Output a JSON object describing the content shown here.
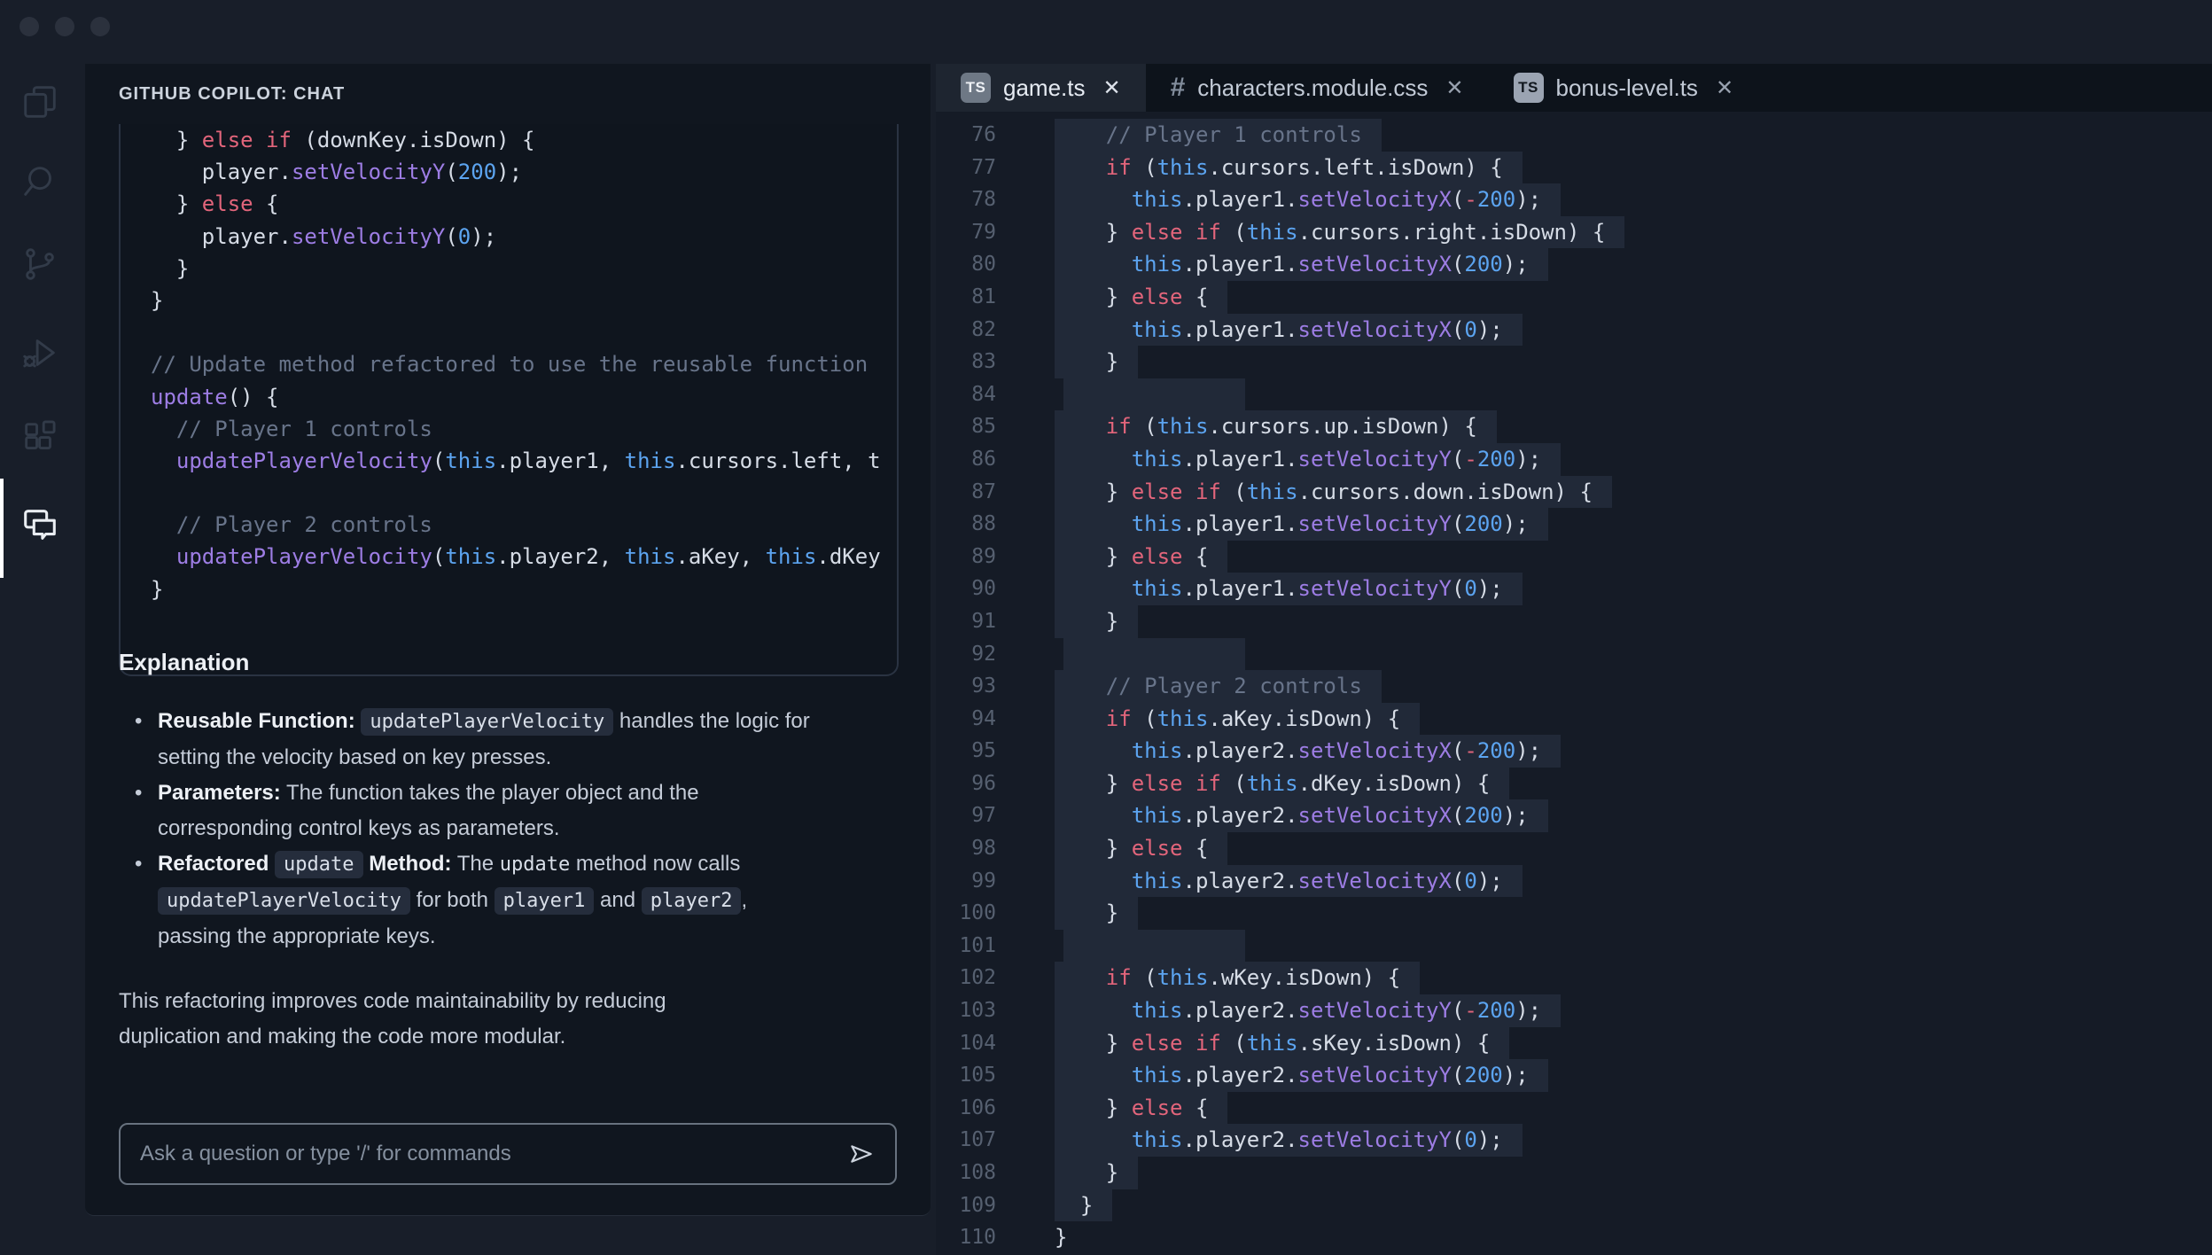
{
  "window": {
    "controls": [
      {
        "icon": "window-close-button"
      },
      {
        "icon": "window-minimize-button"
      },
      {
        "icon": "window-zoom-button"
      }
    ]
  },
  "activity_bar": {
    "items": [
      {
        "icon": "files-icon",
        "active": false
      },
      {
        "icon": "search-icon",
        "active": false
      },
      {
        "icon": "source-control-icon",
        "active": false
      },
      {
        "icon": "run-debug-icon",
        "active": false
      },
      {
        "icon": "extensions-icon",
        "active": false
      },
      {
        "icon": "chat-icon",
        "active": true
      }
    ]
  },
  "colors": {
    "window_bg": "#181e29",
    "panel_bg": "#10161f",
    "editor_bg": "#151b26",
    "tabbar_bg": "#0d131b",
    "active_tab_bg": "#1e2530",
    "highlight_line_bg": "#212938",
    "keyword": "#e2657b",
    "function": "#9d7de4",
    "blue_identifier": "#5ca4f0",
    "comment": "#68748a",
    "plain_code": "#d6dce6",
    "chip_bg": "#252d3c",
    "active_indicator": "#ffffff"
  },
  "chat": {
    "header": "GITHUB COPILOT: CHAT",
    "code_block": {
      "lines": [
        [
          [
            "p",
            "  } "
          ],
          [
            "k",
            "else"
          ],
          [
            "p",
            " "
          ],
          [
            "k",
            "if"
          ],
          [
            "p",
            " (downKey.isDown) {"
          ]
        ],
        [
          [
            "p",
            "    player."
          ],
          [
            "f",
            "setVelocityY"
          ],
          [
            "p",
            "("
          ],
          [
            "n",
            "200"
          ],
          [
            "p",
            ");"
          ]
        ],
        [
          [
            "p",
            "  } "
          ],
          [
            "k",
            "else"
          ],
          [
            "p",
            " {"
          ]
        ],
        [
          [
            "p",
            "    player."
          ],
          [
            "f",
            "setVelocityY"
          ],
          [
            "p",
            "("
          ],
          [
            "n",
            "0"
          ],
          [
            "p",
            ");"
          ]
        ],
        [
          [
            "p",
            "  }"
          ]
        ],
        [
          [
            "p",
            "}"
          ]
        ],
        [],
        [
          [
            "c",
            "// Update method refactored to use the reusable function"
          ]
        ],
        [
          [
            "f",
            "update"
          ],
          [
            "p",
            "() {"
          ]
        ],
        [
          [
            "c",
            "  // Player 1 controls"
          ]
        ],
        [
          [
            "p",
            "  "
          ],
          [
            "f",
            "updatePlayerVelocity"
          ],
          [
            "p",
            "("
          ],
          [
            "t",
            "this"
          ],
          [
            "p",
            ".player1, "
          ],
          [
            "t",
            "this"
          ],
          [
            "p",
            ".cursors.left, t"
          ]
        ],
        [],
        [
          [
            "c",
            "  // Player 2 controls"
          ]
        ],
        [
          [
            "p",
            "  "
          ],
          [
            "f",
            "updatePlayerVelocity"
          ],
          [
            "p",
            "("
          ],
          [
            "t",
            "this"
          ],
          [
            "p",
            ".player2, "
          ],
          [
            "t",
            "this"
          ],
          [
            "p",
            ".aKey, "
          ],
          [
            "t",
            "this"
          ],
          [
            "p",
            ".dKey"
          ]
        ],
        [
          [
            "p",
            "}"
          ]
        ]
      ]
    },
    "explanation": {
      "heading": "Explanation",
      "bullet_glyph": "•",
      "bullets": [
        [
          {
            "s": "b",
            "t": "Reusable Function:"
          },
          {
            "s": "",
            "t": " "
          },
          {
            "s": "ch",
            "t": "updatePlayerVelocity"
          },
          {
            "s": "",
            "t": " handles the logic for setting the velocity based on key presses."
          }
        ],
        [
          {
            "s": "b",
            "t": "Parameters:"
          },
          {
            "s": "",
            "t": " The function takes the player object and the corresponding control keys as parameters."
          }
        ],
        [
          {
            "s": "b",
            "t": "Refactored"
          },
          {
            "s": "",
            "t": " "
          },
          {
            "s": "ch",
            "t": "update"
          },
          {
            "s": "",
            "t": " "
          },
          {
            "s": "b",
            "t": "Method:"
          },
          {
            "s": "",
            "t": " The "
          },
          {
            "s": "mn",
            "t": "update"
          },
          {
            "s": "",
            "t": " method now calls "
          },
          {
            "s": "ch",
            "t": "updatePlayerVelocity"
          },
          {
            "s": "",
            "t": " for both "
          },
          {
            "s": "ch",
            "t": "player1"
          },
          {
            "s": "",
            "t": " and "
          },
          {
            "s": "ch",
            "t": "player2"
          },
          {
            "s": "",
            "t": ", passing the appropriate keys."
          }
        ]
      ]
    },
    "note": "This refactoring improves code maintainability by reducing duplication and making the code more modular.",
    "input": {
      "placeholder": "Ask a question or type '/' for commands",
      "send_icon": "send-icon"
    }
  },
  "editor": {
    "close_glyph": "✕",
    "tabs": [
      {
        "icon": "ts-badge",
        "label": "game.ts",
        "active": true
      },
      {
        "icon": "css-hash-icon",
        "label": "characters.module.css",
        "active": false
      },
      {
        "icon": "ts-badge-light",
        "label": "bonus-level.ts",
        "active": false
      }
    ],
    "lines": [
      {
        "n": 76,
        "hl": true,
        "seg": [
          [
            "c",
            "    // Player 1 controls"
          ]
        ]
      },
      {
        "n": 77,
        "hl": true,
        "seg": [
          [
            "p",
            "    "
          ],
          [
            "k",
            "if"
          ],
          [
            "p",
            " ("
          ],
          [
            "t",
            "this"
          ],
          [
            "p",
            ".cursors.left.isDown) {"
          ]
        ]
      },
      {
        "n": 78,
        "hl": true,
        "seg": [
          [
            "p",
            "      "
          ],
          [
            "t",
            "this"
          ],
          [
            "p",
            ".player1."
          ],
          [
            "f",
            "setVelocityX"
          ],
          [
            "p",
            "("
          ],
          [
            "k",
            "-"
          ],
          [
            "n",
            "200"
          ],
          [
            "p",
            ");"
          ]
        ]
      },
      {
        "n": 79,
        "hl": true,
        "seg": [
          [
            "p",
            "    } "
          ],
          [
            "k",
            "else"
          ],
          [
            "p",
            " "
          ],
          [
            "k",
            "if"
          ],
          [
            "p",
            " ("
          ],
          [
            "t",
            "this"
          ],
          [
            "p",
            ".cursors.right.isDown) {"
          ]
        ]
      },
      {
        "n": 80,
        "hl": true,
        "seg": [
          [
            "p",
            "      "
          ],
          [
            "t",
            "this"
          ],
          [
            "p",
            ".player1."
          ],
          [
            "f",
            "setVelocityX"
          ],
          [
            "p",
            "("
          ],
          [
            "n",
            "200"
          ],
          [
            "p",
            ");"
          ]
        ]
      },
      {
        "n": 81,
        "hl": true,
        "seg": [
          [
            "p",
            "    } "
          ],
          [
            "k",
            "else"
          ],
          [
            "p",
            " {"
          ]
        ]
      },
      {
        "n": 82,
        "hl": true,
        "seg": [
          [
            "p",
            "      "
          ],
          [
            "t",
            "this"
          ],
          [
            "p",
            ".player1."
          ],
          [
            "f",
            "setVelocityX"
          ],
          [
            "p",
            "("
          ],
          [
            "n",
            "0"
          ],
          [
            "p",
            ");"
          ]
        ]
      },
      {
        "n": 83,
        "hl": true,
        "seg": [
          [
            "p",
            "    }"
          ]
        ]
      },
      {
        "n": 84,
        "hl": true,
        "seg": []
      },
      {
        "n": 85,
        "hl": true,
        "seg": [
          [
            "p",
            "    "
          ],
          [
            "k",
            "if"
          ],
          [
            "p",
            " ("
          ],
          [
            "t",
            "this"
          ],
          [
            "p",
            ".cursors.up.isDown) {"
          ]
        ]
      },
      {
        "n": 86,
        "hl": true,
        "seg": [
          [
            "p",
            "      "
          ],
          [
            "t",
            "this"
          ],
          [
            "p",
            ".player1."
          ],
          [
            "f",
            "setVelocityY"
          ],
          [
            "p",
            "("
          ],
          [
            "k",
            "-"
          ],
          [
            "n",
            "200"
          ],
          [
            "p",
            ");"
          ]
        ]
      },
      {
        "n": 87,
        "hl": true,
        "seg": [
          [
            "p",
            "    } "
          ],
          [
            "k",
            "else"
          ],
          [
            "p",
            " "
          ],
          [
            "k",
            "if"
          ],
          [
            "p",
            " ("
          ],
          [
            "t",
            "this"
          ],
          [
            "p",
            ".cursors.down.isDown) {"
          ]
        ]
      },
      {
        "n": 88,
        "hl": true,
        "seg": [
          [
            "p",
            "      "
          ],
          [
            "t",
            "this"
          ],
          [
            "p",
            ".player1."
          ],
          [
            "f",
            "setVelocityY"
          ],
          [
            "p",
            "("
          ],
          [
            "n",
            "200"
          ],
          [
            "p",
            ");"
          ]
        ]
      },
      {
        "n": 89,
        "hl": true,
        "seg": [
          [
            "p",
            "    } "
          ],
          [
            "k",
            "else"
          ],
          [
            "p",
            " {"
          ]
        ]
      },
      {
        "n": 90,
        "hl": true,
        "seg": [
          [
            "p",
            "      "
          ],
          [
            "t",
            "this"
          ],
          [
            "p",
            ".player1."
          ],
          [
            "f",
            "setVelocityY"
          ],
          [
            "p",
            "("
          ],
          [
            "n",
            "0"
          ],
          [
            "p",
            ");"
          ]
        ]
      },
      {
        "n": 91,
        "hl": true,
        "seg": [
          [
            "p",
            "    }"
          ]
        ]
      },
      {
        "n": 92,
        "hl": true,
        "seg": []
      },
      {
        "n": 93,
        "hl": true,
        "seg": [
          [
            "c",
            "    // Player 2 controls"
          ]
        ]
      },
      {
        "n": 94,
        "hl": true,
        "seg": [
          [
            "p",
            "    "
          ],
          [
            "k",
            "if"
          ],
          [
            "p",
            " ("
          ],
          [
            "t",
            "this"
          ],
          [
            "p",
            ".aKey.isDown) {"
          ]
        ]
      },
      {
        "n": 95,
        "hl": true,
        "seg": [
          [
            "p",
            "      "
          ],
          [
            "t",
            "this"
          ],
          [
            "p",
            ".player2."
          ],
          [
            "f",
            "setVelocityX"
          ],
          [
            "p",
            "("
          ],
          [
            "k",
            "-"
          ],
          [
            "n",
            "200"
          ],
          [
            "p",
            ");"
          ]
        ]
      },
      {
        "n": 96,
        "hl": true,
        "seg": [
          [
            "p",
            "    } "
          ],
          [
            "k",
            "else"
          ],
          [
            "p",
            " "
          ],
          [
            "k",
            "if"
          ],
          [
            "p",
            " ("
          ],
          [
            "t",
            "this"
          ],
          [
            "p",
            ".dKey.isDown) {"
          ]
        ]
      },
      {
        "n": 97,
        "hl": true,
        "seg": [
          [
            "p",
            "      "
          ],
          [
            "t",
            "this"
          ],
          [
            "p",
            ".player2."
          ],
          [
            "f",
            "setVelocityX"
          ],
          [
            "p",
            "("
          ],
          [
            "n",
            "200"
          ],
          [
            "p",
            ");"
          ]
        ]
      },
      {
        "n": 98,
        "hl": true,
        "seg": [
          [
            "p",
            "    } "
          ],
          [
            "k",
            "else"
          ],
          [
            "p",
            " {"
          ]
        ]
      },
      {
        "n": 99,
        "hl": true,
        "seg": [
          [
            "p",
            "      "
          ],
          [
            "t",
            "this"
          ],
          [
            "p",
            ".player2."
          ],
          [
            "f",
            "setVelocityX"
          ],
          [
            "p",
            "("
          ],
          [
            "n",
            "0"
          ],
          [
            "p",
            ");"
          ]
        ]
      },
      {
        "n": 100,
        "hl": true,
        "seg": [
          [
            "p",
            "    }"
          ]
        ]
      },
      {
        "n": 101,
        "hl": true,
        "seg": []
      },
      {
        "n": 102,
        "hl": true,
        "seg": [
          [
            "p",
            "    "
          ],
          [
            "k",
            "if"
          ],
          [
            "p",
            " ("
          ],
          [
            "t",
            "this"
          ],
          [
            "p",
            ".wKey.isDown) {"
          ]
        ]
      },
      {
        "n": 103,
        "hl": true,
        "seg": [
          [
            "p",
            "      "
          ],
          [
            "t",
            "this"
          ],
          [
            "p",
            ".player2."
          ],
          [
            "f",
            "setVelocityY"
          ],
          [
            "p",
            "("
          ],
          [
            "k",
            "-"
          ],
          [
            "n",
            "200"
          ],
          [
            "p",
            ");"
          ]
        ]
      },
      {
        "n": 104,
        "hl": true,
        "seg": [
          [
            "p",
            "    } "
          ],
          [
            "k",
            "else"
          ],
          [
            "p",
            " "
          ],
          [
            "k",
            "if"
          ],
          [
            "p",
            " ("
          ],
          [
            "t",
            "this"
          ],
          [
            "p",
            ".sKey.isDown) {"
          ]
        ]
      },
      {
        "n": 105,
        "hl": true,
        "seg": [
          [
            "p",
            "      "
          ],
          [
            "t",
            "this"
          ],
          [
            "p",
            ".player2."
          ],
          [
            "f",
            "setVelocityY"
          ],
          [
            "p",
            "("
          ],
          [
            "n",
            "200"
          ],
          [
            "p",
            ");"
          ]
        ]
      },
      {
        "n": 106,
        "hl": true,
        "seg": [
          [
            "p",
            "    } "
          ],
          [
            "k",
            "else"
          ],
          [
            "p",
            " {"
          ]
        ]
      },
      {
        "n": 107,
        "hl": true,
        "seg": [
          [
            "p",
            "      "
          ],
          [
            "t",
            "this"
          ],
          [
            "p",
            ".player2."
          ],
          [
            "f",
            "setVelocityY"
          ],
          [
            "p",
            "("
          ],
          [
            "n",
            "0"
          ],
          [
            "p",
            ");"
          ]
        ]
      },
      {
        "n": 108,
        "hl": true,
        "seg": [
          [
            "p",
            "    }"
          ]
        ]
      },
      {
        "n": 109,
        "hl": true,
        "seg": [
          [
            "p",
            "  }"
          ]
        ]
      },
      {
        "n": 110,
        "hl": false,
        "seg": [
          [
            "p",
            "}"
          ]
        ]
      }
    ]
  }
}
